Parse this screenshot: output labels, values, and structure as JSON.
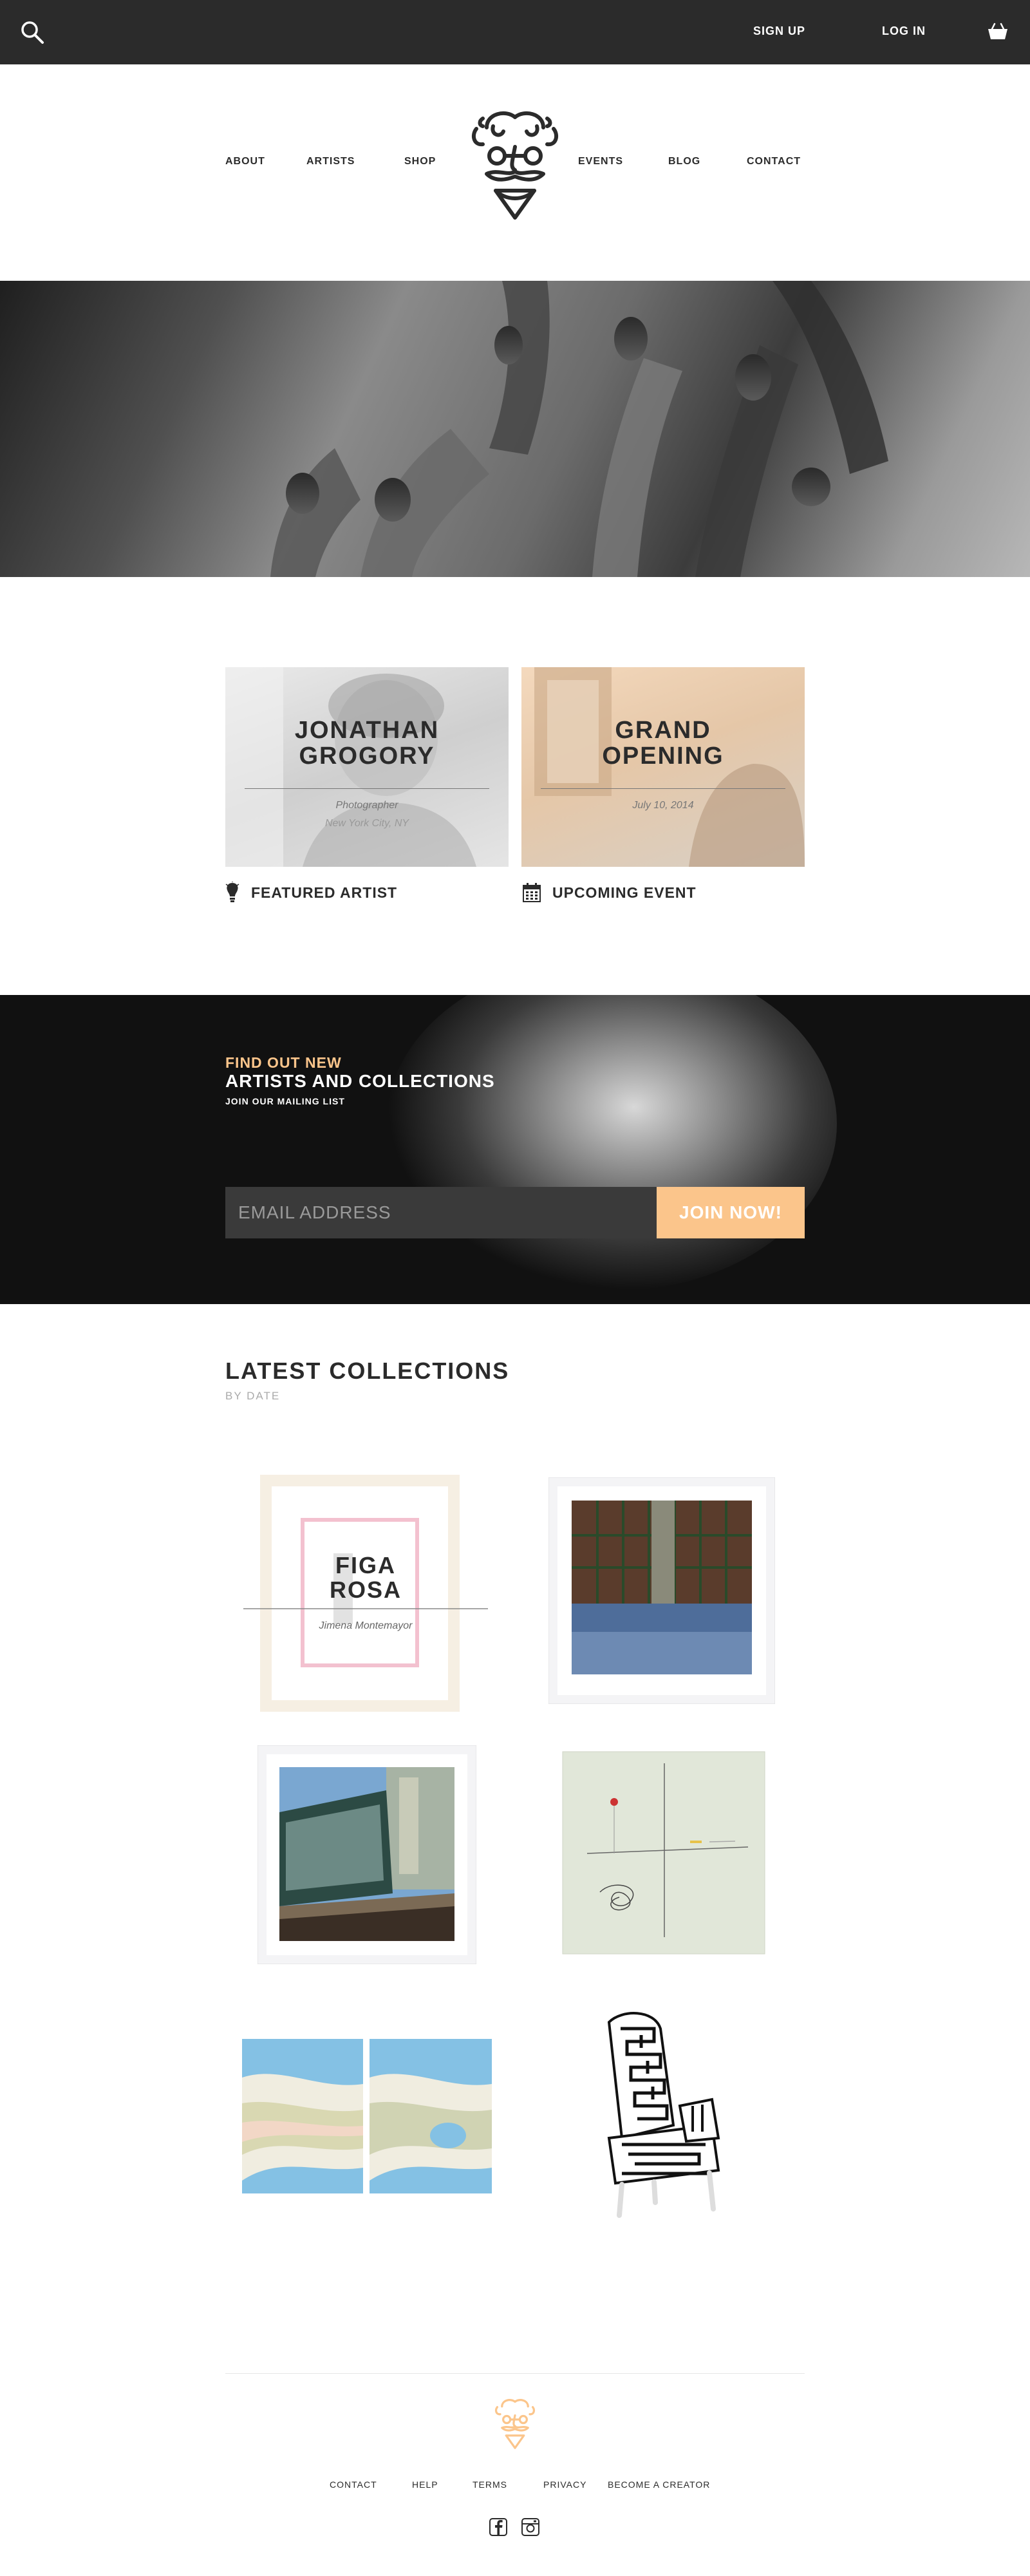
{
  "topbar": {
    "search_icon": "search-icon",
    "signup_label": "SIGN UP",
    "login_label": "LOG IN",
    "cart_icon": "basket-icon"
  },
  "nav": {
    "items": [
      "ABOUT",
      "ARTISTS",
      "SHOP",
      "EVENTS",
      "BLOG",
      "CONTACT"
    ],
    "logo": "face-logo"
  },
  "features": [
    {
      "title_line1": "JONATHAN",
      "title_line2": "GROGORY",
      "sub1": "Photographer",
      "sub2": "New York City, NY",
      "label": "FEATURED ARTIST",
      "icon": "lightbulb-icon"
    },
    {
      "title_line1": "GRAND",
      "title_line2": "OPENING",
      "sub1": "July 10, 2014",
      "label": "UPCOMING EVENT",
      "icon": "calendar-icon"
    }
  ],
  "mailing": {
    "kicker": "FIND OUT NEW",
    "heading": "ARTISTS AND COLLECTIONS",
    "sub": "JOIN OUR MAILING LIST",
    "email_placeholder": "EMAIL ADDRESS",
    "button": "JOIN NOW!"
  },
  "collections": {
    "title": "LATEST COLLECTIONS",
    "subtitle": "BY DATE",
    "overlay": {
      "title_line1": "FIGA",
      "title_line2": "ROSA",
      "artist": "Jimena Montemayor"
    }
  },
  "footer": {
    "links": [
      "CONTACT",
      "HELP",
      "TERMS",
      "PRIVACY",
      "BECOME A CREATOR"
    ],
    "social": [
      "facebook-icon",
      "instagram-icon"
    ]
  },
  "colors": {
    "accent": "#fbc58b",
    "dark": "#2b2b2b"
  }
}
